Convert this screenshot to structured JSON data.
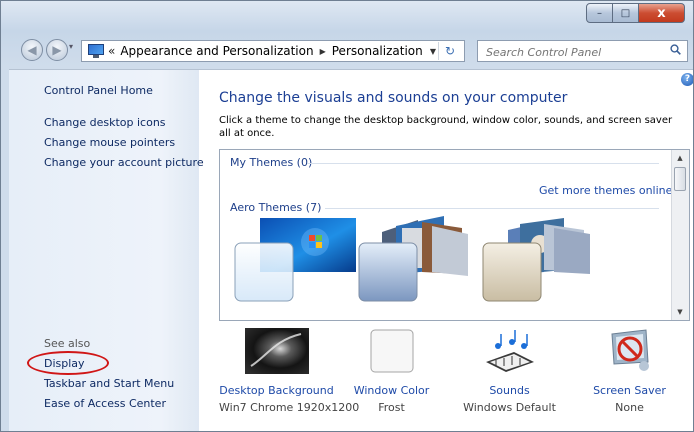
{
  "window": {
    "minimize_glyph": "–",
    "maximize_glyph": "□",
    "close_glyph": "x"
  },
  "navigation": {
    "back_glyph": "◀",
    "forward_glyph": "▶",
    "history_glyph": "▾",
    "breadcrumb_overflow": "«",
    "breadcrumbs": [
      "Appearance and Personalization",
      "Personalization"
    ],
    "separator_glyph": "▶",
    "dropdown_glyph": "▼",
    "refresh_glyph": "↻",
    "search_placeholder": "Search Control Panel"
  },
  "sidebar": {
    "home_link": "Control Panel Home",
    "tasks": [
      "Change desktop icons",
      "Change mouse pointers",
      "Change your account picture"
    ],
    "see_also_label": "See also",
    "see_also_links": [
      "Display",
      "Taskbar and Start Menu",
      "Ease of Access Center"
    ],
    "highlighted_link": "Display",
    "highlight_color": "#d01616"
  },
  "main": {
    "help_glyph": "?",
    "heading": "Change the visuals and sounds on your computer",
    "description": "Click a theme to change the desktop background, window color, sounds, and screen saver all at once.",
    "my_themes_label": "My Themes (0)",
    "more_themes_link": "Get more themes online",
    "aero_themes_label": "Aero Themes (7)",
    "scroll_up_glyph": "▲",
    "scroll_down_glyph": "▼",
    "theme_count_visible": 3
  },
  "bottom_options": [
    {
      "label": "Desktop Background",
      "value": "Win7 Chrome 1920x1200"
    },
    {
      "label": "Window Color",
      "value": "Frost"
    },
    {
      "label": "Sounds",
      "value": "Windows Default"
    },
    {
      "label": "Screen Saver",
      "value": "None"
    }
  ],
  "colors": {
    "link": "#1e4aa8",
    "heading": "#1c3f94",
    "sidebar_bg": "#e6eef8",
    "accent_close": "#c23a1e"
  }
}
